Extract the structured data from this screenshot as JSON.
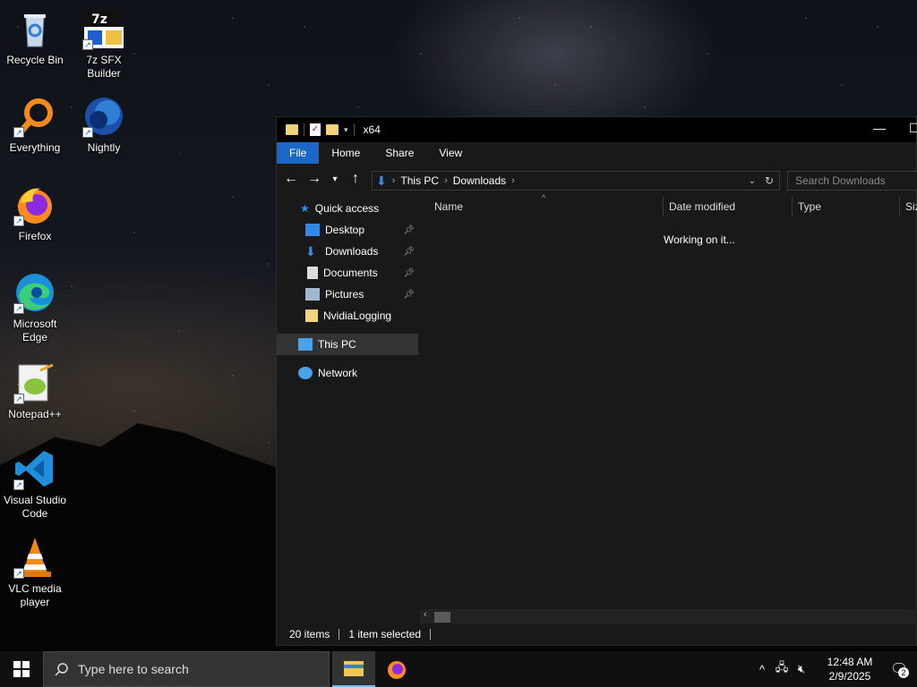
{
  "desktop": {
    "icons": [
      {
        "label": "Recycle Bin"
      },
      {
        "label": "7z SFX Builder"
      },
      {
        "label": "Everything"
      },
      {
        "label": "Nightly"
      },
      {
        "label": "Firefox"
      },
      {
        "label": "Microsoft Edge"
      },
      {
        "label": "Notepad++"
      },
      {
        "label": "Visual Studio Code"
      },
      {
        "label": "VLC media player"
      }
    ]
  },
  "explorer": {
    "title": "x64",
    "ribbon_tabs": [
      "File",
      "Home",
      "Share",
      "View"
    ],
    "breadcrumb": [
      "This PC",
      "Downloads"
    ],
    "search_placeholder": "Search Downloads",
    "nav": {
      "quick_access": "Quick access",
      "pinned": [
        "Desktop",
        "Downloads",
        "Documents",
        "Pictures"
      ],
      "other": "NvidiaLogging",
      "this_pc": "This PC",
      "network": "Network"
    },
    "columns": [
      "Name",
      "Date modified",
      "Type",
      "Size"
    ],
    "loading_text": "Working on it...",
    "status": {
      "items": "20 items",
      "selected": "1 item selected"
    }
  },
  "taskbar": {
    "search_placeholder": "Type here to search",
    "time": "12:48 AM",
    "date": "2/9/2025",
    "notification_count": "2"
  },
  "colors": {
    "accent": "#1b67c8",
    "folder": "#f3d27a"
  }
}
